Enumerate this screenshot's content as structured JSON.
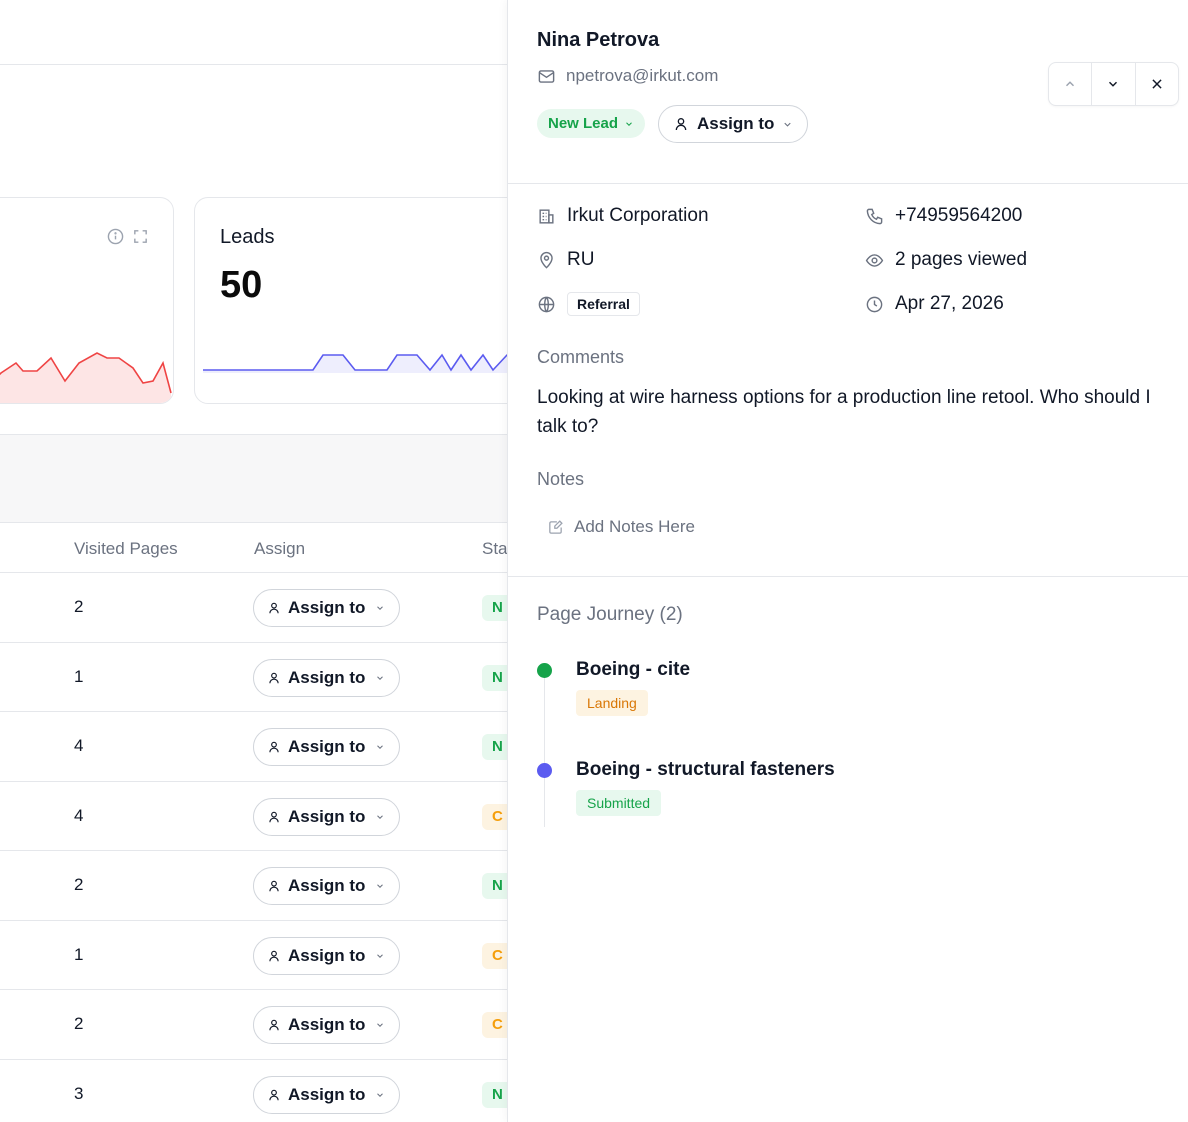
{
  "background": {
    "cards": [
      {
        "title": "",
        "value": ""
      },
      {
        "title": "Leads",
        "value": "50"
      }
    ],
    "table": {
      "columns": [
        "Visited Pages",
        "Assign",
        "Sta"
      ],
      "rows": [
        {
          "pages": "2",
          "assign": "Assign to",
          "status": "N",
          "status_color": "green"
        },
        {
          "pages": "1",
          "assign": "Assign to",
          "status": "N",
          "status_color": "green"
        },
        {
          "pages": "4",
          "assign": "Assign to",
          "status": "N",
          "status_color": "green"
        },
        {
          "pages": "4",
          "assign": "Assign to",
          "status": "C",
          "status_color": "orange"
        },
        {
          "pages": "2",
          "assign": "Assign to",
          "status": "N",
          "status_color": "green"
        },
        {
          "pages": "1",
          "assign": "Assign to",
          "status": "C",
          "status_color": "orange"
        },
        {
          "pages": "2",
          "assign": "Assign to",
          "status": "C",
          "status_color": "orange"
        },
        {
          "pages": "3",
          "assign": "Assign to",
          "status": "N",
          "status_color": "green"
        }
      ]
    }
  },
  "drawer": {
    "name": "Nina Petrova",
    "email": "npetrova@irkut.com",
    "lead_status": "New Lead",
    "assign_label": "Assign to",
    "company": "Irkut Corporation",
    "phone": "+74959564200",
    "country": "RU",
    "pages_viewed": "2 pages viewed",
    "source": "Referral",
    "date": "Apr 27, 2026",
    "comments_label": "Comments",
    "comment": "Looking at wire harness options for a production line retool. Who should I talk to?",
    "notes_label": "Notes",
    "notes_placeholder": "Add Notes Here",
    "journey_title": "Page Journey (2)",
    "journey": [
      {
        "title": "Boeing - cite",
        "badge": "Landing",
        "dot_color": "#16a34a"
      },
      {
        "title": "Boeing - structural fasteners",
        "badge": "Submitted",
        "dot_color": "#5b5bf0"
      }
    ]
  },
  "colors": {
    "accent_green": "#16a34a",
    "accent_indigo": "#5b5bf0",
    "spark_red": "#ef4444",
    "border": "#e5e7eb"
  }
}
